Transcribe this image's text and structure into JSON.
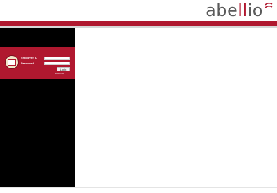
{
  "brand": {
    "logo_prefix": "abe",
    "logo_accent": "ll",
    "logo_suffix": "io",
    "primary_color": "#b0182f",
    "text_color": "#5b5b5b"
  },
  "login": {
    "employee_id_label": "Employee ID",
    "password_label": "Password",
    "employee_id_value": "",
    "password_value": "",
    "login_button": "Login",
    "forgot_link": "Lost Pass"
  },
  "icons": {
    "login_badge": "id-card-icon",
    "logo_mark": "swoosh-icon"
  }
}
